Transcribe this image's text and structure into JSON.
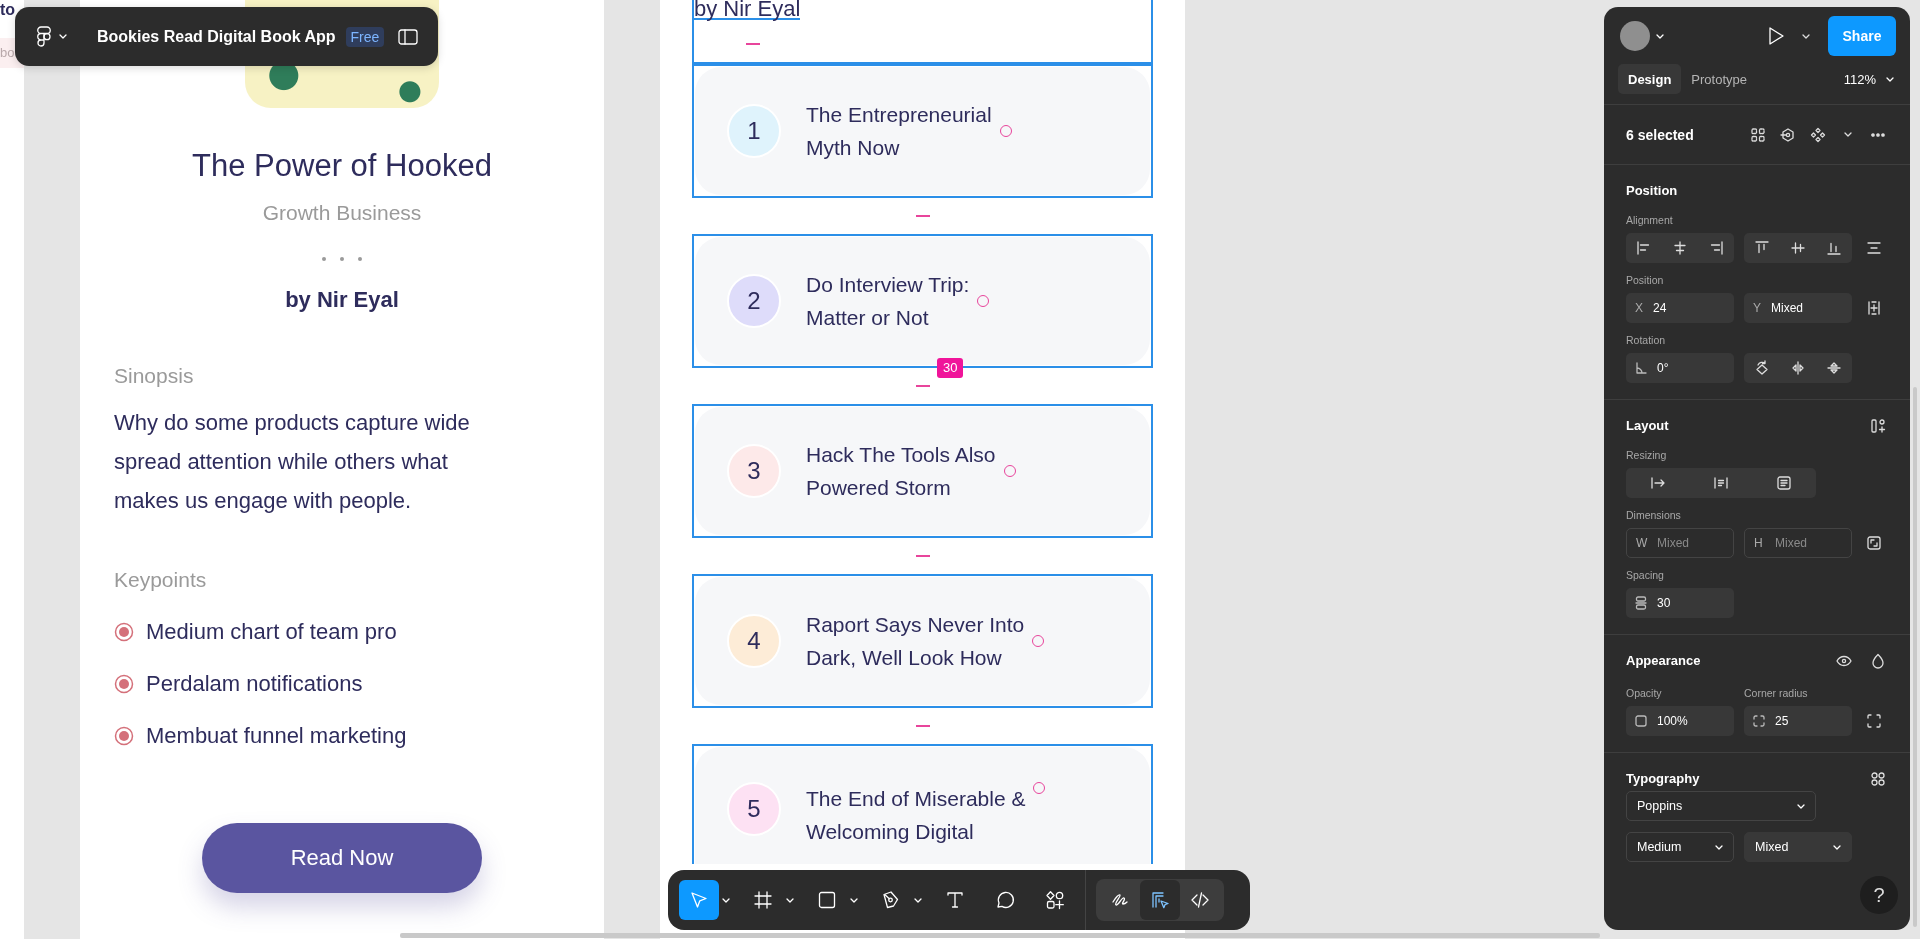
{
  "file_bar": {
    "title": "Bookies Read Digital Book App",
    "plan": "Free"
  },
  "canvas": {
    "edge_frame": {
      "texts": [
        "to",
        "bo"
      ]
    },
    "detail_frame": {
      "title": "The Power of Hooked",
      "category": "Growth Business",
      "author": "by Nir Eyal",
      "synopsis_label": "Sinopsis",
      "synopsis": "Why do some products capture wide\nspread attention while others what\nmakes us engage with people.",
      "keypoints_label": "Keypoints",
      "keypoints": [
        "Medium chart of team pro",
        "Perdalam notifications",
        "Membuat funnel marketing"
      ],
      "button": "Read Now"
    },
    "chapter_frame": {
      "author": {
        "text": "by Nir Eyal",
        "selected": true
      },
      "chapters": [
        {
          "number": "1",
          "title": "The Entrepreneurial\nMyth Now",
          "color": "#dff3fc",
          "selected": true
        },
        {
          "number": "2",
          "title": "Do Interview Trip:\nMatter or Not",
          "color": "#dedcfa",
          "selected": true,
          "spacing_badge": "30"
        },
        {
          "number": "3",
          "title": "Hack The Tools Also\nPowered Storm",
          "color": "#fde9e9",
          "selected": true
        },
        {
          "number": "4",
          "title": "Raport Says Never Into\nDark, Well Look How",
          "color": "#fdecd7",
          "selected": true
        },
        {
          "number": "5",
          "title": "The End of Miserable &\nWelcoming Digital",
          "color": "#fde1f3",
          "selected": true
        }
      ]
    }
  },
  "toolbar": {
    "tools": [
      {
        "kind": "move",
        "selected": true,
        "menu": true
      },
      {
        "kind": "frame",
        "selected": false,
        "menu": true
      },
      {
        "kind": "shape",
        "selected": false,
        "menu": true
      },
      {
        "kind": "pen",
        "selected": false,
        "menu": true
      },
      {
        "kind": "text",
        "selected": false,
        "menu": false
      },
      {
        "kind": "comment",
        "selected": false,
        "menu": false
      },
      {
        "kind": "actions",
        "selected": false,
        "menu": false
      }
    ],
    "modes": [
      {
        "kind": "draw",
        "selected": false
      },
      {
        "kind": "design",
        "selected": true
      },
      {
        "kind": "dev",
        "selected": false
      }
    ]
  },
  "properties": {
    "share": "Share",
    "tabs": [
      {
        "label": "Design",
        "selected": true
      },
      {
        "label": "Prototype",
        "selected": false
      }
    ],
    "zoom": "112%",
    "selection": "6 selected",
    "position": {
      "title": "Position",
      "alignment_label": "Alignment",
      "position_label": "Position",
      "x": {
        "prefix": "X",
        "value": "24"
      },
      "y": {
        "prefix": "Y",
        "value": "Mixed"
      },
      "rotation_label": "Rotation",
      "rotation": "0°"
    },
    "layout": {
      "title": "Layout",
      "resizing_label": "Resizing",
      "dimensions_label": "Dimensions",
      "w": {
        "prefix": "W",
        "placeholder": "Mixed"
      },
      "h": {
        "prefix": "H",
        "placeholder": "Mixed"
      },
      "spacing_label": "Spacing",
      "spacing": "30"
    },
    "appearance": {
      "title": "Appearance",
      "opacity_label": "Opacity",
      "opacity": "100%",
      "radius_label": "Corner radius",
      "radius": "25"
    },
    "typography": {
      "title": "Typography",
      "font": "Poppins",
      "weight": "Medium",
      "size": "Mixed"
    },
    "help": "?"
  }
}
